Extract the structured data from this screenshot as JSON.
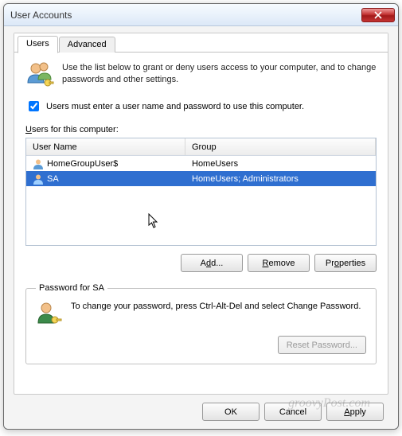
{
  "window": {
    "title": "User Accounts"
  },
  "tabs": {
    "users": "Users",
    "advanced": "Advanced"
  },
  "intro": "Use the list below to grant or deny users access to your computer, and to change passwords and other settings.",
  "checkbox": {
    "label": "Users must enter a user name and password to use this computer.",
    "checked": true
  },
  "listLabel": "Users for this computer:",
  "columns": {
    "name": "User Name",
    "group": "Group"
  },
  "rows": [
    {
      "name": "HomeGroupUser$",
      "group": "HomeUsers",
      "selected": false
    },
    {
      "name": "SA",
      "group": "HomeUsers; Administrators",
      "selected": true
    }
  ],
  "buttons": {
    "add": "Add...",
    "remove": "Remove",
    "properties": "Properties",
    "reset": "Reset Password...",
    "ok": "OK",
    "cancel": "Cancel",
    "apply": "Apply"
  },
  "passwordBox": {
    "legend": "Password for SA",
    "text": "To change your password, press Ctrl-Alt-Del and select Change Password."
  },
  "watermark": "groovyPost.com"
}
